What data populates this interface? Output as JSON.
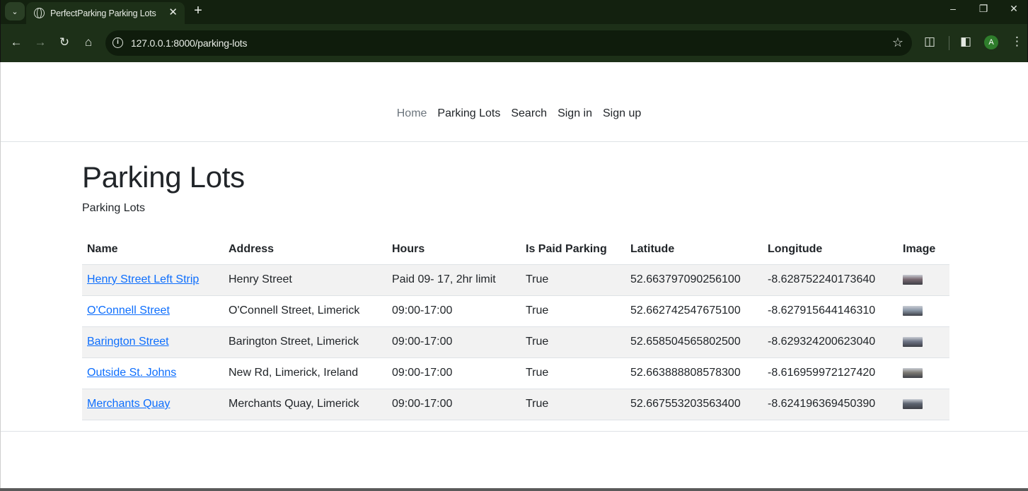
{
  "browser": {
    "tab_title": "PerfectParking Parking Lots",
    "tab_close": "✕",
    "new_tab": "+",
    "url": "127.0.0.1:8000/parking-lots",
    "profile_initial": "A",
    "icons": [
      "tab-list-icon",
      "globe-icon",
      "close-icon",
      "plus-icon",
      "minimize-icon",
      "restore-icon",
      "close-window-icon",
      "back-icon",
      "forward-icon",
      "reload-icon",
      "home-icon",
      "info-icon",
      "star-icon",
      "extensions-icon",
      "side-panel-icon",
      "menu-icon"
    ]
  },
  "nav": {
    "items": [
      {
        "label": "Home"
      },
      {
        "label": "Parking Lots"
      },
      {
        "label": "Search"
      },
      {
        "label": "Sign in"
      },
      {
        "label": "Sign up"
      }
    ]
  },
  "main": {
    "title": "Parking Lots",
    "subtitle": "Parking Lots",
    "table": {
      "headers": [
        "Name",
        "Address",
        "Hours",
        "Is Paid Parking",
        "Latitude",
        "Longitude",
        "Image"
      ],
      "rows": [
        {
          "name": "Henry Street Left Strip",
          "address": "Henry Street",
          "hours": "Paid 09- 17, 2hr limit",
          "paid": "True",
          "lat": "52.663797090256100",
          "lng": "-8.628752240173640",
          "thumb_color": "#7a6a72"
        },
        {
          "name": "O'Connell Street",
          "address": "O'Connell Street, Limerick",
          "hours": "09:00-17:00",
          "paid": "True",
          "lat": "52.662742547675100",
          "lng": "-8.627915644146310",
          "thumb_color": "#8a96a6"
        },
        {
          "name": "Barington Street",
          "address": "Barington Street, Limerick",
          "hours": "09:00-17:00",
          "paid": "True",
          "lat": "52.658504565802500",
          "lng": "-8.629324200623040",
          "thumb_color": "#6e7486"
        },
        {
          "name": "Outside St. Johns",
          "address": "New Rd, Limerick, Ireland",
          "hours": "09:00-17:00",
          "paid": "True",
          "lat": "52.663888808578300",
          "lng": "-8.616959972127420",
          "thumb_color": "#7d7a74"
        },
        {
          "name": "Merchants Quay",
          "address": "Merchants Quay, Limerick",
          "hours": "09:00-17:00",
          "paid": "True",
          "lat": "52.667553203563400",
          "lng": "-8.624196369450390",
          "thumb_color": "#5d6470"
        }
      ]
    }
  },
  "colors": {
    "link": "#0d6efd",
    "chrome_bg": "#1d3018",
    "stripe": "#f2f2f2"
  }
}
